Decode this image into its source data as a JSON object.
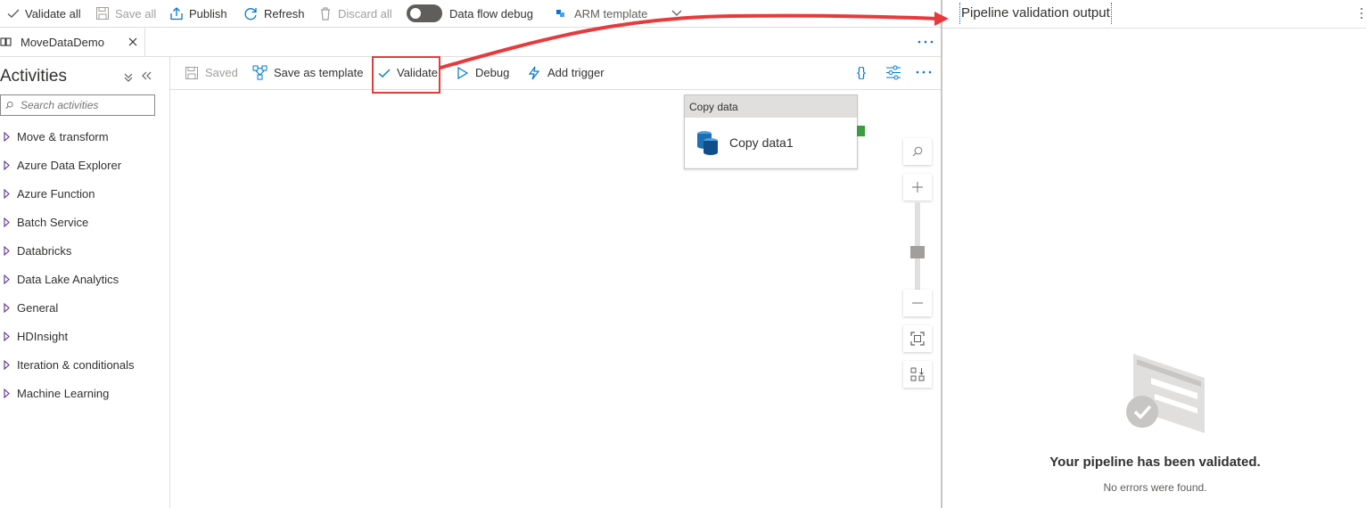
{
  "toolbar": {
    "validate_all": "Validate all",
    "save_all": "Save all",
    "publish": "Publish",
    "refresh": "Refresh",
    "discard_all": "Discard all",
    "data_flow_debug": "Data flow debug",
    "arm_template": "ARM template"
  },
  "tab": {
    "title": "MoveDataDemo"
  },
  "activities": {
    "title": "Activities",
    "search_placeholder": "Search activities",
    "items": [
      {
        "label": "Move & transform"
      },
      {
        "label": "Azure Data Explorer"
      },
      {
        "label": "Azure Function"
      },
      {
        "label": "Batch Service"
      },
      {
        "label": "Databricks"
      },
      {
        "label": "Data Lake Analytics"
      },
      {
        "label": "General"
      },
      {
        "label": "HDInsight"
      },
      {
        "label": "Iteration & conditionals"
      },
      {
        "label": "Machine Learning"
      }
    ]
  },
  "canvas_toolbar": {
    "saved": "Saved",
    "save_as_template": "Save as template",
    "validate": "Validate",
    "debug": "Debug",
    "add_trigger": "Add trigger",
    "code": "{}"
  },
  "card": {
    "header": "Copy data",
    "name": "Copy data1"
  },
  "validation": {
    "title": "Pipeline validation output",
    "message": "Your pipeline has been validated.",
    "sub": "No errors were found."
  },
  "colors": {
    "accent": "#0078d4",
    "highlight": "#e8393c",
    "success": "#3e9c40"
  }
}
